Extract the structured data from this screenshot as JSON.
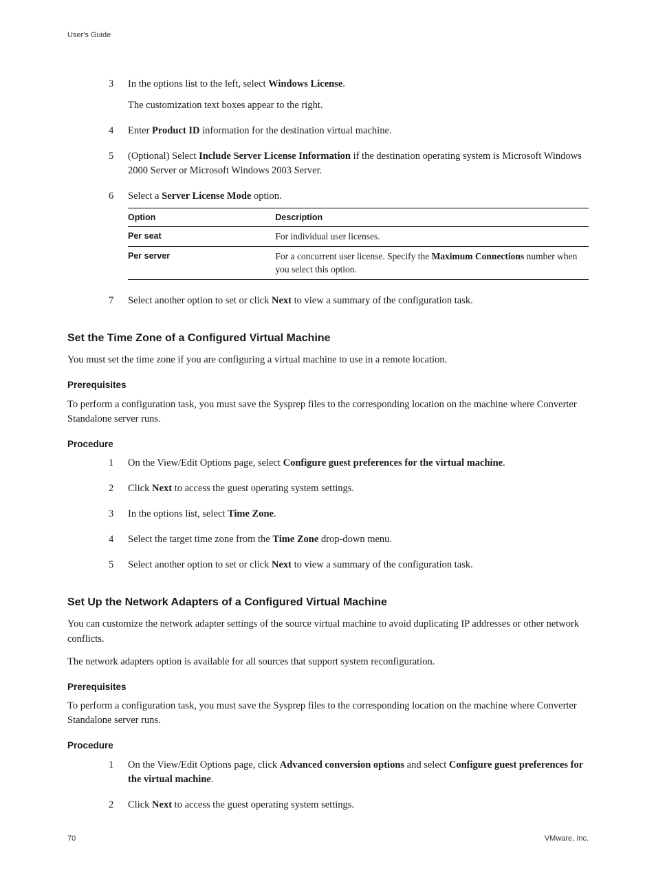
{
  "header": {
    "title": "User's Guide"
  },
  "steps_a": [
    {
      "num": "3",
      "parts": [
        "In the options list to the left, select ",
        "Windows License",
        "."
      ],
      "sub": "The customization text boxes appear to the right."
    },
    {
      "num": "4",
      "parts": [
        "Enter ",
        "Product ID",
        " information for the destination virtual machine."
      ]
    },
    {
      "num": "5",
      "parts": [
        "(Optional) Select ",
        "Include Server License Information",
        " if the destination operating system is Microsoft Windows 2000 Server or Microsoft Windows 2003 Server."
      ]
    },
    {
      "num": "6",
      "parts": [
        "Select a ",
        "Server License Mode",
        " option."
      ]
    }
  ],
  "table": {
    "headers": [
      "Option",
      "Description"
    ],
    "rows": [
      {
        "opt": "Per seat",
        "desc_parts": [
          "For individual user licenses."
        ]
      },
      {
        "opt": "Per server",
        "desc_parts": [
          "For a concurrent user license. Specify the ",
          "Maximum Connections",
          " number when you select this option."
        ]
      }
    ]
  },
  "step_a7": {
    "num": "7",
    "parts": [
      "Select another option to set or click ",
      "Next",
      " to view a summary of the configuration task."
    ]
  },
  "section_tz": {
    "title": "Set the Time Zone of a Configured Virtual Machine",
    "intro": "You must set the time zone if you are configuring a virtual machine to use in a remote location.",
    "prereq_h": "Prerequisites",
    "prereq": "To perform a configuration task, you must save the Sysprep files to the corresponding location on the machine where Converter Standalone server runs.",
    "proc_h": "Procedure",
    "steps": [
      {
        "num": "1",
        "parts": [
          "On the View/Edit Options page, select ",
          "Configure guest preferences for the virtual machine",
          "."
        ]
      },
      {
        "num": "2",
        "parts": [
          "Click ",
          "Next",
          " to access the guest operating system settings."
        ]
      },
      {
        "num": "3",
        "parts": [
          "In the options list, select ",
          "Time Zone",
          "."
        ]
      },
      {
        "num": "4",
        "parts": [
          "Select the target time zone from the ",
          "Time Zone",
          " drop-down menu."
        ]
      },
      {
        "num": "5",
        "parts": [
          "Select another option to set or click ",
          "Next",
          " to view a summary of the configuration task."
        ]
      }
    ]
  },
  "section_net": {
    "title": "Set Up the Network Adapters of a Configured Virtual Machine",
    "intro1": "You can customize the network adapter settings of the source virtual machine to avoid duplicating IP addresses or other network conflicts.",
    "intro2": "The network adapters option is available for all sources that support system reconfiguration.",
    "prereq_h": "Prerequisites",
    "prereq": "To perform a configuration task, you must save the Sysprep files to the corresponding location on the machine where Converter Standalone server runs.",
    "proc_h": "Procedure",
    "steps": [
      {
        "num": "1",
        "parts": [
          "On the View/Edit Options page, click ",
          "Advanced conversion options",
          " and select ",
          "Configure guest preferences for the virtual machine",
          "."
        ]
      },
      {
        "num": "2",
        "parts": [
          "Click ",
          "Next",
          " to access the guest operating system settings."
        ]
      }
    ]
  },
  "footer": {
    "page": "70",
    "company": "VMware, Inc."
  }
}
